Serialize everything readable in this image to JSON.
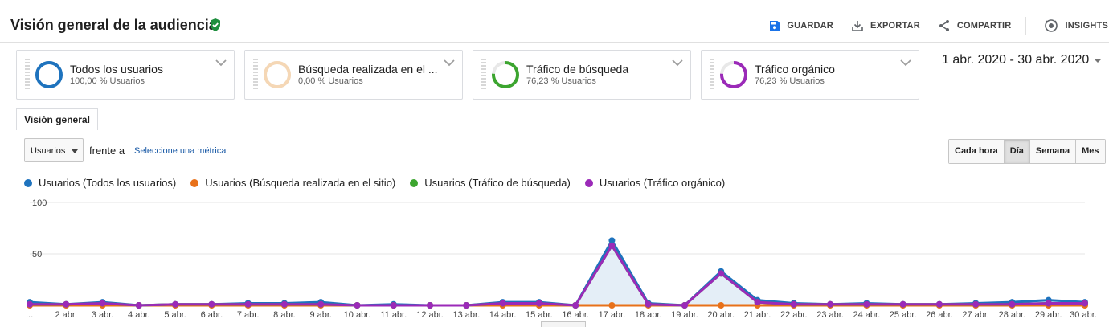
{
  "header": {
    "title": "Visión general de la audiencia",
    "actions": [
      {
        "label": "GUARDAR",
        "icon": "save-icon"
      },
      {
        "label": "EXPORTAR",
        "icon": "download-icon"
      },
      {
        "label": "COMPARTIR",
        "icon": "share-icon"
      },
      {
        "label": "INSIGHTS",
        "icon": "insights-icon"
      }
    ]
  },
  "segments": [
    {
      "name": "Todos los usuarios",
      "pct": "100,00 % Usuarios",
      "color": "#1e73be",
      "fill": 1.0
    },
    {
      "name": "Búsqueda realizada en el ...",
      "pct": "0,00 % Usuarios",
      "color": "#f5d7b5",
      "fill": 1.0
    },
    {
      "name": "Tráfico de búsqueda",
      "pct": "76,23 % Usuarios",
      "color": "#3ca52f",
      "fill": 0.7623
    },
    {
      "name": "Tráfico orgánico",
      "pct": "76,23 % Usuarios",
      "color": "#9b2ab8",
      "fill": 0.7623
    }
  ],
  "date_range": "1 abr. 2020 - 30 abr. 2020",
  "tabs": [
    {
      "label": "Visión general"
    }
  ],
  "controls": {
    "metric": "Usuarios",
    "versus": "frente a",
    "pick_metric": "Seleccione una métrica",
    "granularity": [
      "Cada hora",
      "Día",
      "Semana",
      "Mes"
    ],
    "granularity_active": "Día"
  },
  "chart_data": {
    "type": "line",
    "x": [
      "...",
      "2 abr.",
      "3 abr.",
      "4 abr.",
      "5 abr.",
      "6 abr.",
      "7 abr.",
      "8 abr.",
      "9 abr.",
      "10 abr.",
      "11 abr.",
      "12 abr.",
      "13 abr.",
      "14 abr.",
      "15 abr.",
      "16 abr.",
      "17 abr.",
      "18 abr.",
      "19 abr.",
      "20 abr.",
      "21 abr.",
      "22 abr.",
      "23 abr.",
      "24 abr.",
      "25 abr.",
      "26 abr.",
      "27 abr.",
      "28 abr.",
      "29 abr.",
      "30 abr."
    ],
    "yticks": [
      "100",
      "50"
    ],
    "ylim": [
      0,
      100
    ],
    "grid": true,
    "legend_position": "top-left",
    "series": [
      {
        "name": "Usuarios (Todos los usuarios)",
        "color": "#1e73be",
        "values": [
          3,
          1,
          3,
          0,
          1,
          1,
          2,
          2,
          3,
          0,
          1,
          0,
          0,
          3,
          3,
          0,
          63,
          2,
          0,
          33,
          5,
          2,
          1,
          2,
          1,
          1,
          2,
          3,
          5,
          3
        ]
      },
      {
        "name": "Usuarios (Búsqueda realizada en el sitio)",
        "color": "#e8711a",
        "values": [
          0,
          0,
          0,
          0,
          0,
          0,
          0,
          0,
          0,
          0,
          0,
          0,
          0,
          0,
          0,
          0,
          0,
          0,
          0,
          0,
          0,
          0,
          0,
          0,
          0,
          0,
          0,
          0,
          0,
          0
        ]
      },
      {
        "name": "Usuarios (Tráfico de búsqueda)",
        "color": "#3ca52f",
        "values": [
          1,
          1,
          2,
          0,
          1,
          1,
          1,
          1,
          1,
          0,
          0,
          0,
          0,
          2,
          2,
          0,
          58,
          1,
          0,
          31,
          3,
          1,
          1,
          1,
          1,
          1,
          1,
          1,
          2,
          2
        ]
      },
      {
        "name": "Usuarios (Tráfico orgánico)",
        "color": "#9b2ab8",
        "values": [
          1,
          1,
          2,
          0,
          1,
          1,
          1,
          1,
          1,
          0,
          0,
          0,
          0,
          2,
          2,
          0,
          58,
          1,
          0,
          31,
          3,
          1,
          1,
          1,
          1,
          1,
          1,
          1,
          2,
          2
        ]
      }
    ]
  }
}
